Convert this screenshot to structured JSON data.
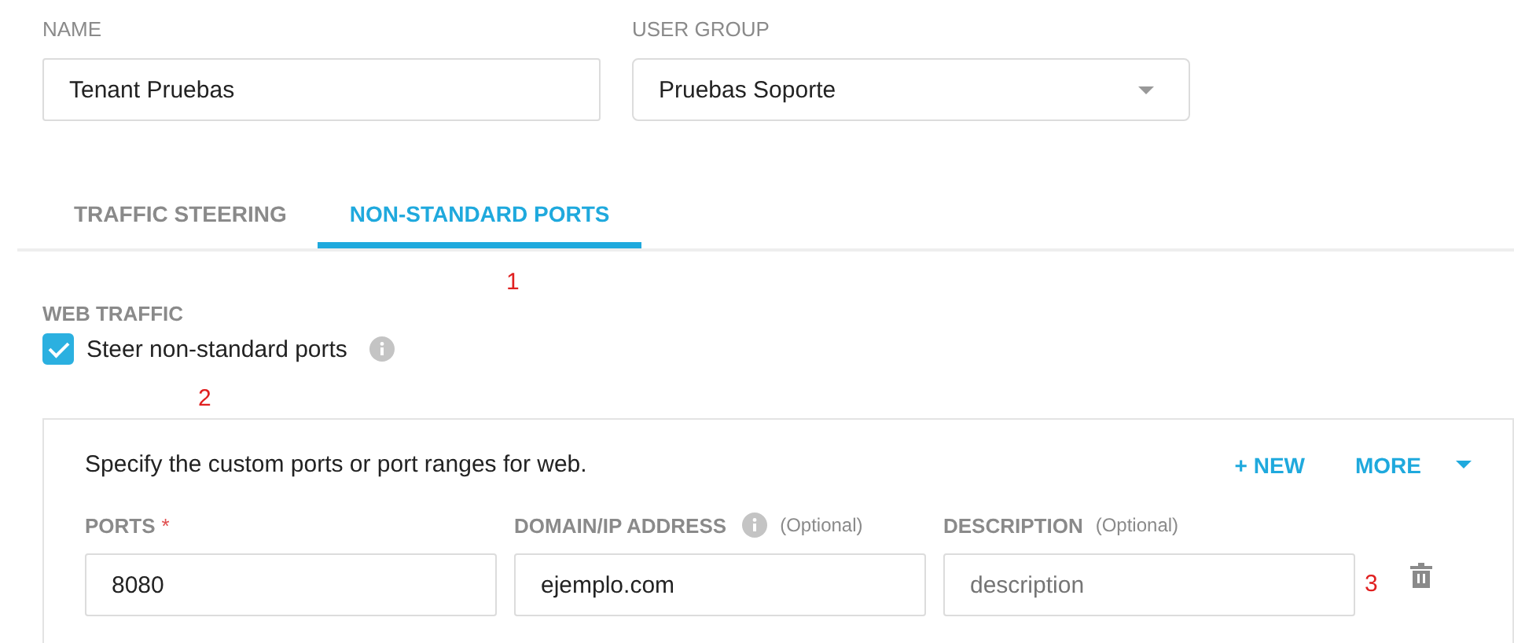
{
  "fields": [
    {
      "label": "NAME",
      "kind": "text",
      "value": "Tenant Pruebas"
    },
    {
      "label": "USER GROUP",
      "kind": "select",
      "value": "Pruebas Soporte"
    }
  ],
  "tabs": [
    {
      "label": "TRAFFIC STEERING",
      "selected": false
    },
    {
      "label": "NON-STANDARD PORTS",
      "selected": true
    }
  ],
  "section": {
    "title": "WEB TRAFFIC",
    "checkbox": {
      "label": "Steer non-standard ports",
      "checked": true
    }
  },
  "panel": {
    "text": "Specify the custom ports or port ranges for web.",
    "actions": [
      {
        "label": "+ NEW",
        "kind": "plain"
      },
      {
        "label": "MORE",
        "kind": "menu"
      }
    ],
    "columns": [
      {
        "label": "PORTS",
        "required": "*",
        "info": false
      },
      {
        "label": "DOMAIN/IP ADDRESS",
        "info": true,
        "optional": "(Optional)"
      },
      {
        "label": "DESCRIPTION",
        "info": false,
        "optional": "(Optional)"
      }
    ],
    "row": [
      {
        "value": "8080"
      },
      {
        "value": "ejemplo.com"
      },
      {
        "placeholder": "description"
      }
    ]
  },
  "annotations": [
    "1",
    "2",
    "3"
  ]
}
